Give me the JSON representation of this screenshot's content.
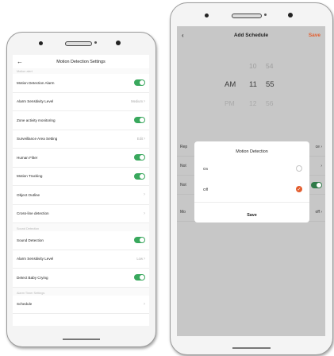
{
  "left": {
    "header": {
      "back_icon": "←",
      "title": "Motion Detection Settings"
    },
    "section_motion": "Motion alert",
    "rows_motion": [
      {
        "label": "Motion Detection Alarm",
        "control": "toggle"
      },
      {
        "label": "Alarm Sensitivity Level",
        "value": "Medium",
        "control": "chevron"
      },
      {
        "label": "Zone activity monitoring",
        "control": "toggle"
      },
      {
        "label": "Surveillance Area Setting",
        "value": "Edit",
        "control": "chevron"
      },
      {
        "label": "Human Filter",
        "control": "toggle"
      },
      {
        "label": "Motion Tracking",
        "control": "toggle"
      },
      {
        "label": "Object Outline",
        "control": "chevron"
      },
      {
        "label": "Cross-line detection",
        "control": "chevron"
      }
    ],
    "section_sound": "Sound Detection",
    "rows_sound": [
      {
        "label": "Sound Detection",
        "control": "toggle"
      },
      {
        "label": "Alarm Sensitivity Level",
        "value": "Low",
        "control": "chevron"
      },
      {
        "label": "Detect Baby Crying",
        "control": "toggle"
      }
    ],
    "section_timer": "Alarm Timer Settings",
    "rows_timer": [
      {
        "label": "Schedule",
        "control": "chevron"
      }
    ],
    "chevron_glyph": "›",
    "accent_toggle": "#39a85d"
  },
  "right": {
    "header": {
      "back_icon": "‹",
      "title": "Add Schedule",
      "save": "Save"
    },
    "picker": {
      "top": {
        "h": "10",
        "m": "54"
      },
      "ampm_top": "AM",
      "selected": {
        "ampm": "AM",
        "h": "11",
        "m": "55"
      },
      "bottom": {
        "ampm": "PM",
        "h": "12",
        "m": "56"
      }
    },
    "bg_rows": [
      {
        "left": "Rep",
        "right": "ce ›"
      },
      {
        "left": "Not",
        "right": "›"
      },
      {
        "left": "Not",
        "right": ""
      },
      {
        "left": "Mo",
        "right": "off ›"
      }
    ],
    "modal": {
      "title": "Motion Detection",
      "options": [
        {
          "label": "On",
          "selected": false
        },
        {
          "label": "Off",
          "selected": true
        }
      ],
      "save": "Save",
      "check_glyph": "✓"
    },
    "accent": "#e35d2e"
  }
}
